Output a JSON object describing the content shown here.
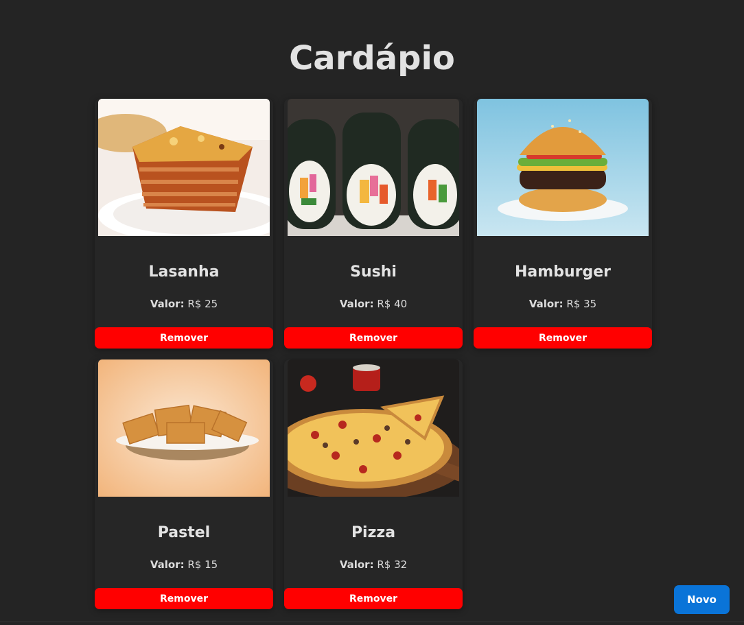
{
  "page": {
    "title": "Cardápio"
  },
  "menu": {
    "price_label": "Valor:",
    "remove_label": "Remover",
    "items": [
      {
        "name": "Lasanha",
        "price": "R$ 25",
        "image": "lasagna-photo"
      },
      {
        "name": "Sushi",
        "price": "R$ 40",
        "image": "sushi-photo"
      },
      {
        "name": "Hamburger",
        "price": "R$ 35",
        "image": "hamburger-photo"
      },
      {
        "name": "Pastel",
        "price": "R$ 15",
        "image": "pastel-photo"
      },
      {
        "name": "Pizza",
        "price": "R$ 32",
        "image": "pizza-photo"
      }
    ]
  },
  "actions": {
    "new_label": "Novo"
  },
  "colors": {
    "background": "#242424",
    "remove_button": "#ff0000",
    "new_button": "#0a74d8"
  }
}
